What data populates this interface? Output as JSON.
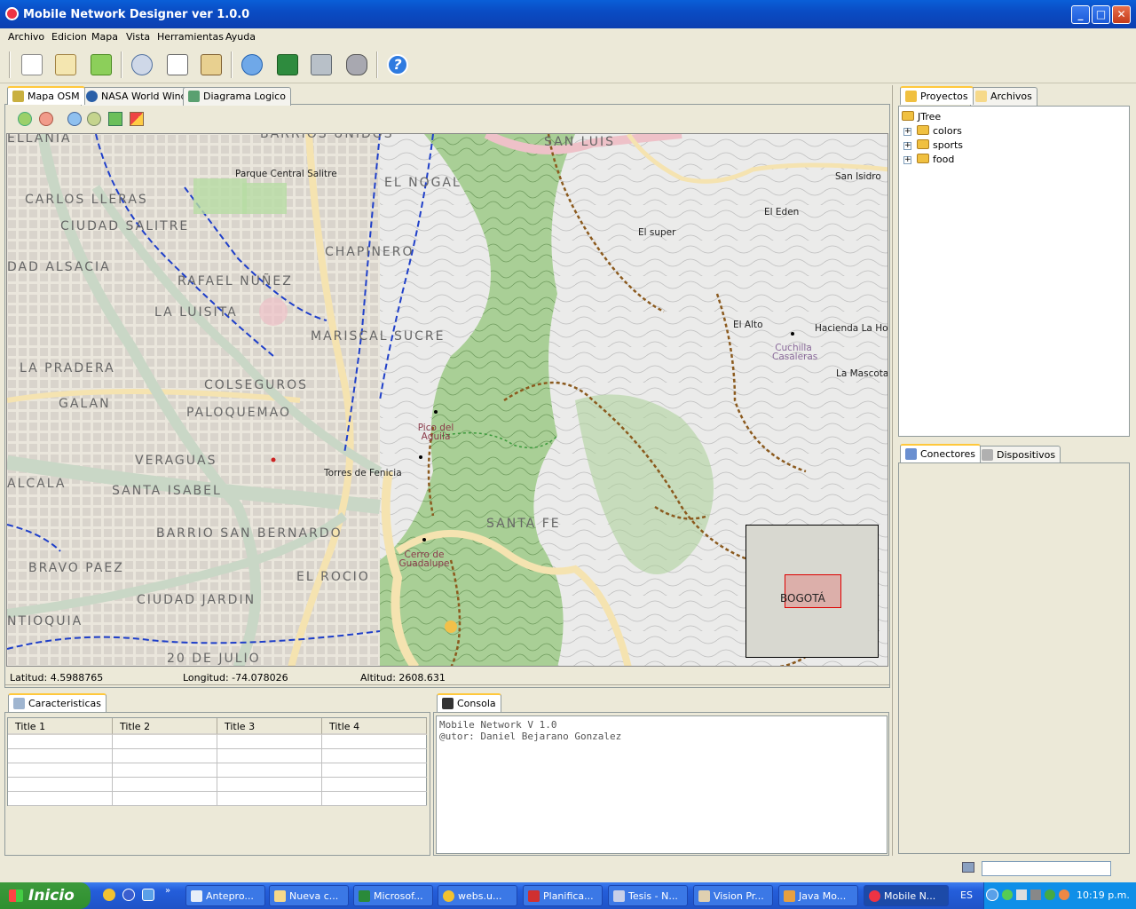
{
  "window": {
    "title": "Mobile Network Designer ver 1.0.0",
    "min": "_",
    "max": "□",
    "close": "✕"
  },
  "menu": [
    "Archivo",
    "Edicion",
    "Mapa",
    "Vista",
    "Herramientas",
    "Ayuda"
  ],
  "toolbar": {
    "icons": [
      "new-file-icon",
      "open-file-icon",
      "download-icon",
      "cut-icon",
      "copy-icon",
      "paste-icon",
      "refresh-icon",
      "excel-icon",
      "tools-icon",
      "database-icon",
      "help-icon"
    ]
  },
  "map_tabs": [
    "Mapa OSM",
    "NASA World Wind",
    "Diagrama Logico"
  ],
  "map": {
    "areas": [
      "BARRIOS UNIDOS",
      "ELLANIA",
      "CARLOS LLERAS",
      "CIUDAD SALITRE",
      "DAD ALSACIA",
      "RAFAEL NUÑEZ",
      "LA LUISITA",
      "CHAPINERO",
      "EL NOGAL",
      "SAN LUIS",
      "MARISCAL SUCRE",
      "LA PRADERA",
      "COLSEGUROS",
      "GALAN",
      "PALOQUEMAO",
      "VERAGUAS",
      "ALCALA",
      "SANTA ISABEL",
      "BARRIO SAN BERNARDO",
      "SANTA FE",
      "BRAVO PAEZ",
      "EL ROCIO",
      "CIUDAD JARDIN",
      "NTIOQUIA",
      "20 DE JULIO"
    ],
    "pois": [
      "Parque Central Salitre",
      "San Isidro",
      "El Eden",
      "El super",
      "El Alto",
      "Hacienda La Hor",
      "Cuchilla Casaleras",
      "La Mascota",
      "Pico del Aguila",
      "Torres de Fenicia",
      "Cerro de Guadalupe"
    ],
    "minimap_label": "BOGOTÁ"
  },
  "status": {
    "lat": "Latitud: 4.5988765",
    "lon": "Longitud: -74.078026",
    "alt": "Altitud: 2608.631"
  },
  "bottom_tabs": {
    "props": "Caracteristicas",
    "console": "Consola"
  },
  "table": {
    "columns": [
      "Title 1",
      "Title 2",
      "Title 3",
      "Title 4"
    ]
  },
  "console": {
    "lines": [
      "Mobile Network V 1.0",
      "@utor: Daniel Bejarano Gonzalez"
    ]
  },
  "right_tabs_top": [
    "Proyectos",
    "Archivos"
  ],
  "tree": {
    "root": "JTree",
    "children": [
      "colors",
      "sports",
      "food"
    ]
  },
  "right_tabs_bottom": [
    "Conectores",
    "Dispositivos"
  ],
  "taskbar": {
    "start": "Inicio",
    "tasks": [
      "Antepro...",
      "Nueva c...",
      "Microsof...",
      "webs.u...",
      "Planifica...",
      "Tesis - N...",
      "Vision Pr...",
      "Java Mo...",
      "Mobile N..."
    ],
    "lang": "ES",
    "clock": "10:19 p.m."
  }
}
